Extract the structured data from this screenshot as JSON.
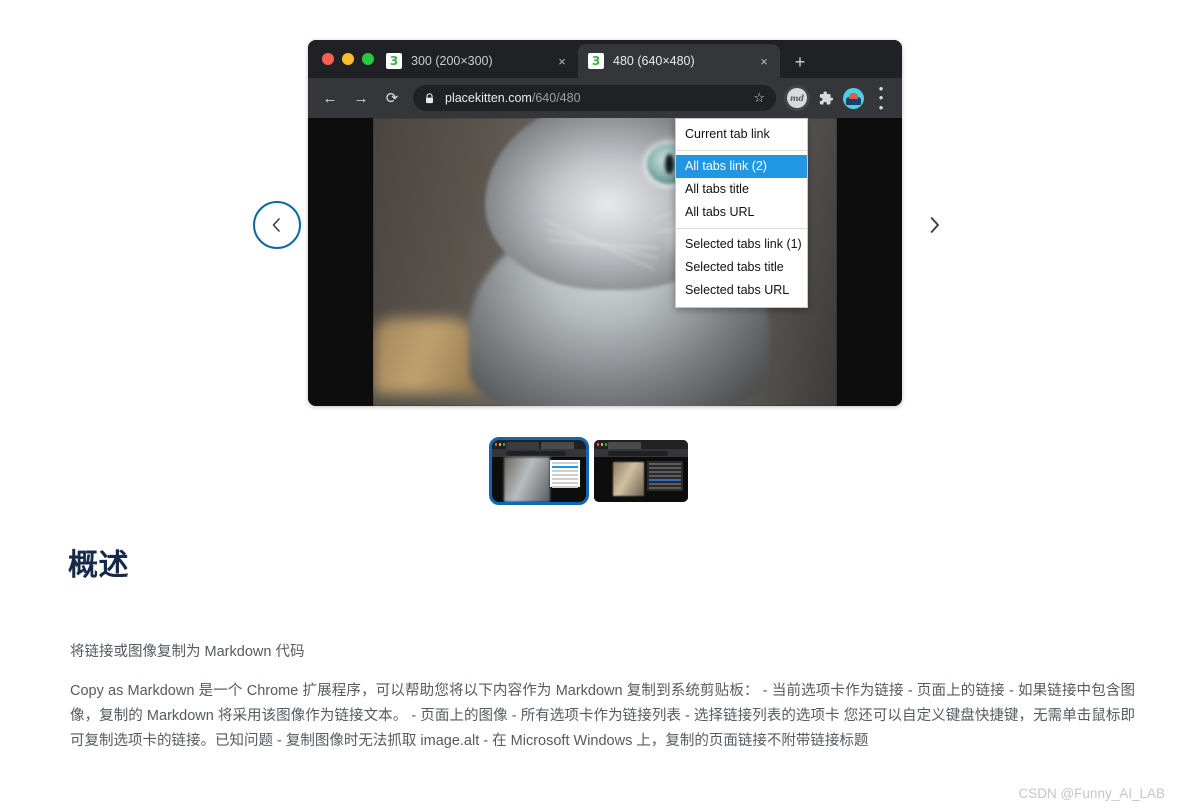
{
  "browser_screenshot": {
    "window_controls": [
      "close",
      "minimize",
      "maximize"
    ],
    "tabs": [
      {
        "favicon": "placekitten-favicon",
        "title": "300 (200×300)",
        "active": false,
        "close_label": "×"
      },
      {
        "favicon": "placekitten-favicon",
        "title": "480 (640×480)",
        "active": true,
        "close_label": "×"
      }
    ],
    "new_tab_label": "+",
    "toolbar": {
      "back_label": "←",
      "forward_label": "→",
      "reload_label": "⟳",
      "lock_icon": "lock-icon",
      "url_domain": "placekitten.com",
      "url_path": "/640/480",
      "bookmark_label": "☆",
      "extension_badge_label": "md",
      "extensions_icon": "puzzle-piece-icon",
      "avatar_icon": "profile-avatar",
      "menu_label": "⋮"
    },
    "page_content": {
      "image_alt": "kitten photo from placekitten.com"
    },
    "dropdown": {
      "groups": [
        {
          "items": [
            {
              "label": "Current tab link",
              "selected": false
            }
          ]
        },
        {
          "items": [
            {
              "label": "All tabs link (2)",
              "selected": true
            },
            {
              "label": "All tabs title",
              "selected": false
            },
            {
              "label": "All tabs URL",
              "selected": false
            }
          ]
        },
        {
          "items": [
            {
              "label": "Selected tabs link (1)",
              "selected": false
            },
            {
              "label": "Selected tabs title",
              "selected": false
            },
            {
              "label": "Selected tabs URL",
              "selected": false
            }
          ]
        }
      ],
      "highlight_color": "#2196e3"
    }
  },
  "carousel": {
    "prev_label": "‹",
    "next_label": "›",
    "active_index": 0,
    "thumbnails": [
      {
        "name": "screenshot-thumbnail-1",
        "active": true
      },
      {
        "name": "screenshot-thumbnail-2",
        "active": false
      }
    ],
    "active_ring_color": "#1167b1"
  },
  "article": {
    "heading": "概述",
    "lead": "将链接或图像复制为 Markdown 代码",
    "body": "Copy as Markdown 是一个 Chrome 扩展程序，可以帮助您将以下内容作为 Markdown 复制到系统剪贴板： - 当前选项卡作为链接 - 页面上的链接 - 如果链接中包含图像，复制的 Markdown 将采用该图像作为链接文本。 - 页面上的图像 - 所有选项卡作为链接列表 - 选择链接列表的选项卡 您还可以自定义键盘快捷键，无需单击鼠标即可复制选项卡的链接。已知问题 - 复制图像时无法抓取 image.alt - 在 Microsoft Windows 上，复制的页面链接不附带链接标题",
    "heading_color": "#15294b"
  },
  "watermark": "CSDN @Funny_AI_LAB"
}
